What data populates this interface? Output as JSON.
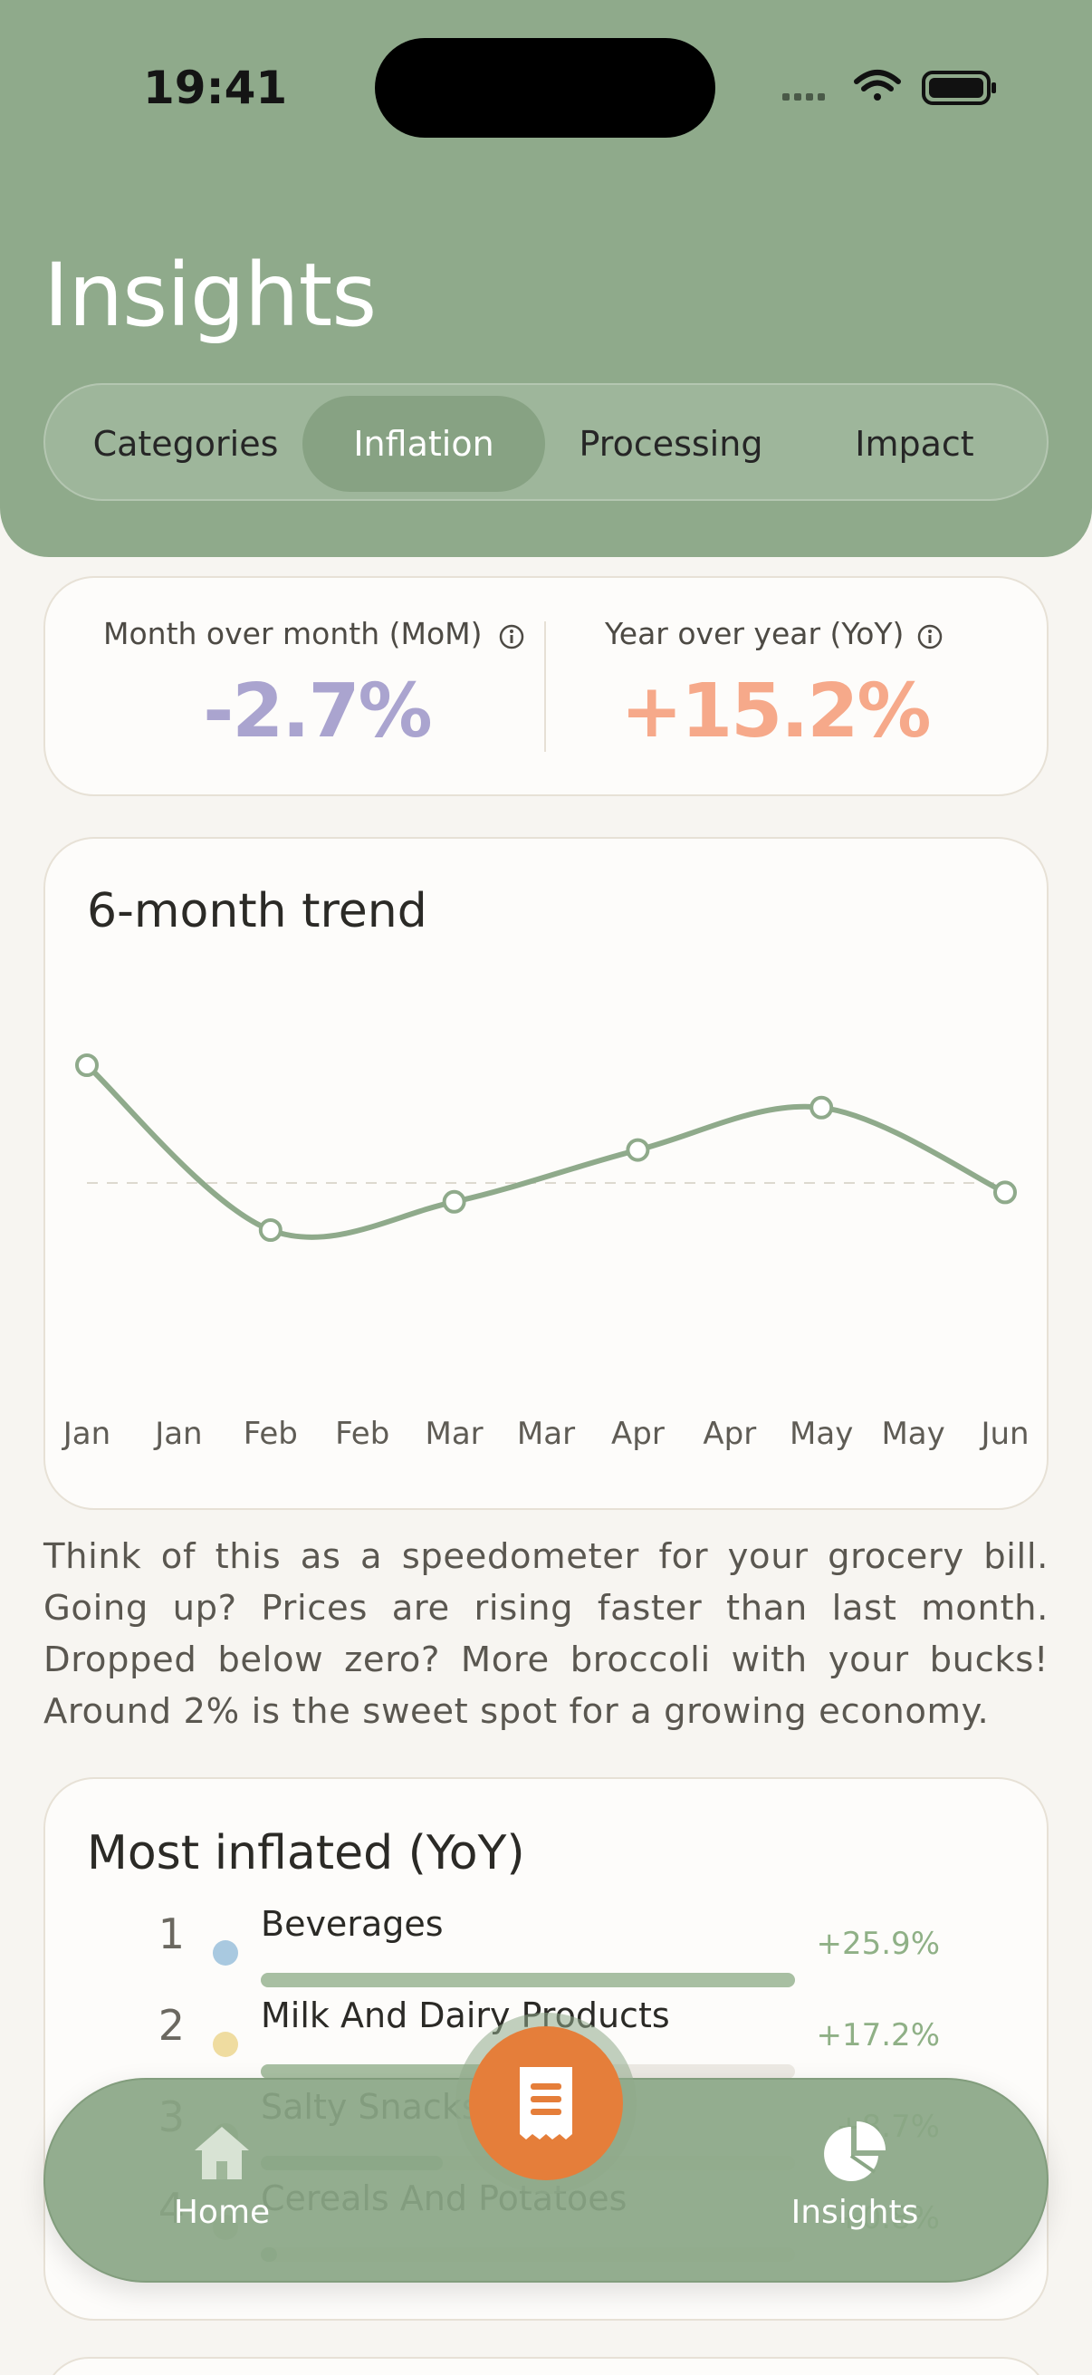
{
  "status_bar": {
    "time": "19:41"
  },
  "header": {
    "title": "Insights",
    "tabs": [
      {
        "label": "Categories"
      },
      {
        "label": "Inflation"
      },
      {
        "label": "Processing"
      },
      {
        "label": "Impact"
      }
    ],
    "active_tab": "Inflation"
  },
  "kpis": {
    "mom": {
      "label": "Month over month (MoM)",
      "value": "-2.7%"
    },
    "yoy": {
      "label": "Year over year (YoY)",
      "value": "+15.2%"
    }
  },
  "trend": {
    "title": "6-month trend"
  },
  "chart_data": {
    "type": "line",
    "title": "6-month trend",
    "x_tick_labels": [
      "Jan",
      "Jan",
      "Feb",
      "Feb",
      "Mar",
      "Mar",
      "Apr",
      "Apr",
      "May",
      "May",
      "Jun"
    ],
    "series": [
      {
        "x": [
          "Jan",
          "Feb",
          "Mar",
          "Apr",
          "May",
          "Jun"
        ],
        "values": [
          2.5,
          -1.0,
          -0.4,
          0.7,
          1.6,
          -0.2
        ]
      }
    ],
    "zero_line": "dashed",
    "y_axis_labels": "none",
    "grid": false,
    "line_color": "#8faa8b"
  },
  "explanation": "Think of this as a speedometer for your grocery bill. Going up? Prices are rising faster than last month. Dropped below zero? More broccoli with your bucks! Around 2% is the sweet spot for a growing economy.",
  "most_inflated": {
    "title": "Most inflated (YoY)",
    "items": [
      {
        "rank": "1",
        "name": "Beverages",
        "pct": "+25.9%",
        "share": 1.0,
        "color": "#a9c9e0"
      },
      {
        "rank": "2",
        "name": "Milk And Dairy Products",
        "pct": "+17.2%",
        "share": 0.66,
        "color": "#efdca0"
      },
      {
        "rank": "3",
        "name": "Salty Snacks",
        "pct": "+8.7%",
        "share": 0.34,
        "color": "#b7cfb1"
      },
      {
        "rank": "4",
        "name": "Cereals And Potatoes",
        "pct": "+0.8%",
        "share": 0.03,
        "color": "#c8d6c3"
      }
    ]
  },
  "nav": {
    "home_label": "Home",
    "insights_label": "Insights",
    "scan_icon": "receipt-icon"
  },
  "colors": {
    "header_green": "#8faa8b",
    "mom_purple": "#aaa4cf",
    "yoy_orange": "#f6a98a",
    "fab_orange": "#e57e3a"
  }
}
